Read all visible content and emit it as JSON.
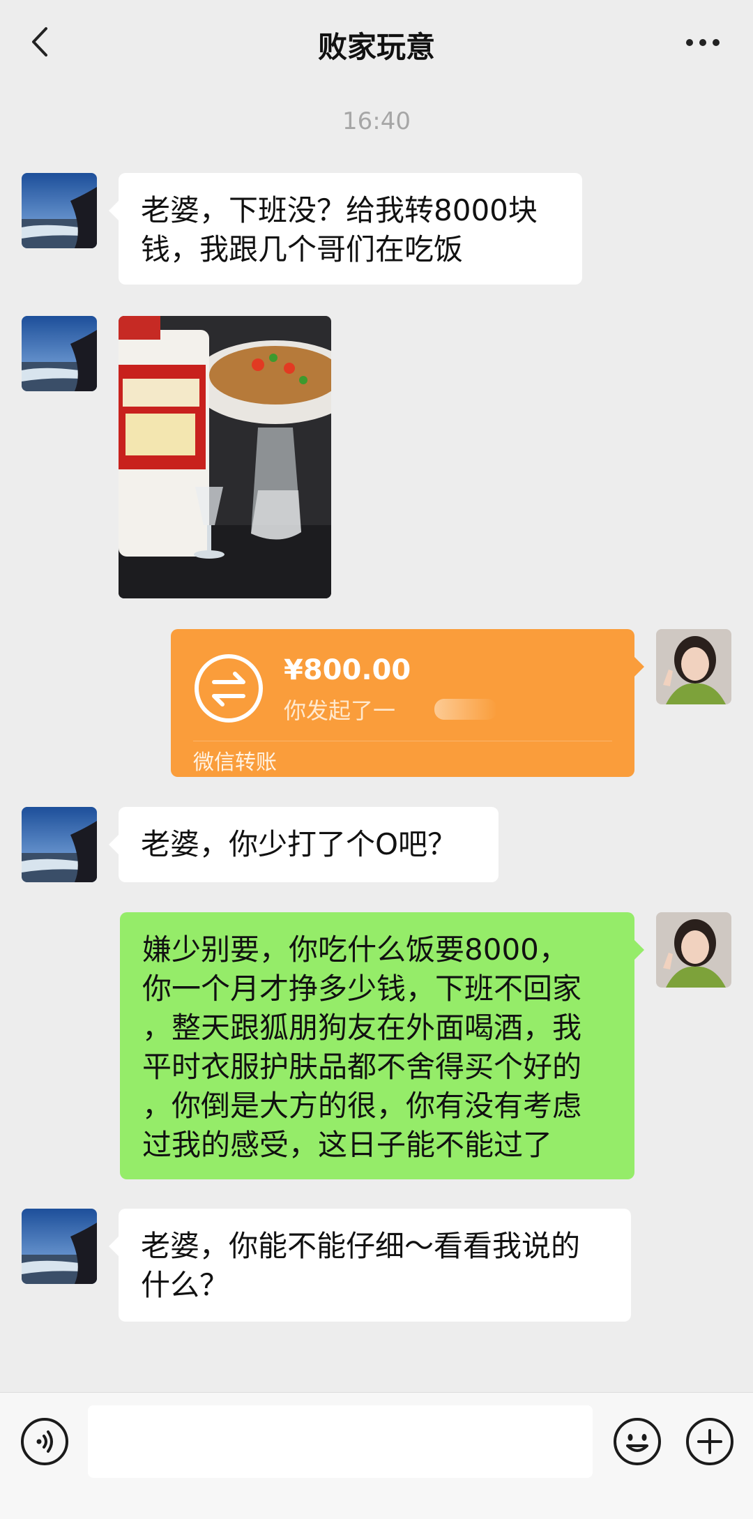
{
  "header": {
    "title": "败家玩意",
    "back_icon": "chevron-left-icon",
    "more_icon": "more-dots-icon"
  },
  "timestamp": "16:40",
  "messages": [
    {
      "sender": "him",
      "type": "text",
      "lines": [
        "老婆，下班没？给我转8000块",
        "钱，我跟几个哥们在吃饭"
      ]
    },
    {
      "sender": "him",
      "type": "image"
    },
    {
      "sender": "her",
      "type": "transfer",
      "amount": "¥800.00",
      "note": "你发起了一",
      "label": "微信转账"
    },
    {
      "sender": "him",
      "type": "text",
      "lines": [
        "老婆，你少打了个O吧？"
      ]
    },
    {
      "sender": "her",
      "type": "text",
      "lines": [
        "嫌少别要，你吃什么饭要8000，",
        "你一个月才挣多少钱，下班不回家",
        "，整天跟狐朋狗友在外面喝酒，我",
        "平时衣服护肤品都不舍得买个好的",
        "，你倒是大方的很，你有没有考虑",
        "过我的感受，这日子能不能过了"
      ]
    },
    {
      "sender": "him",
      "type": "text",
      "lines": [
        "老婆，你能不能仔细～看看我说的",
        "什么？"
      ]
    }
  ],
  "input_bar": {
    "voice_icon": "voice-icon",
    "emoji_icon": "emoji-icon",
    "plus_icon": "plus-icon",
    "input_value": ""
  },
  "colors": {
    "background": "#ededed",
    "bubble_white": "#ffffff",
    "bubble_green": "#95ec69",
    "transfer_orange": "#fa9d3b"
  }
}
